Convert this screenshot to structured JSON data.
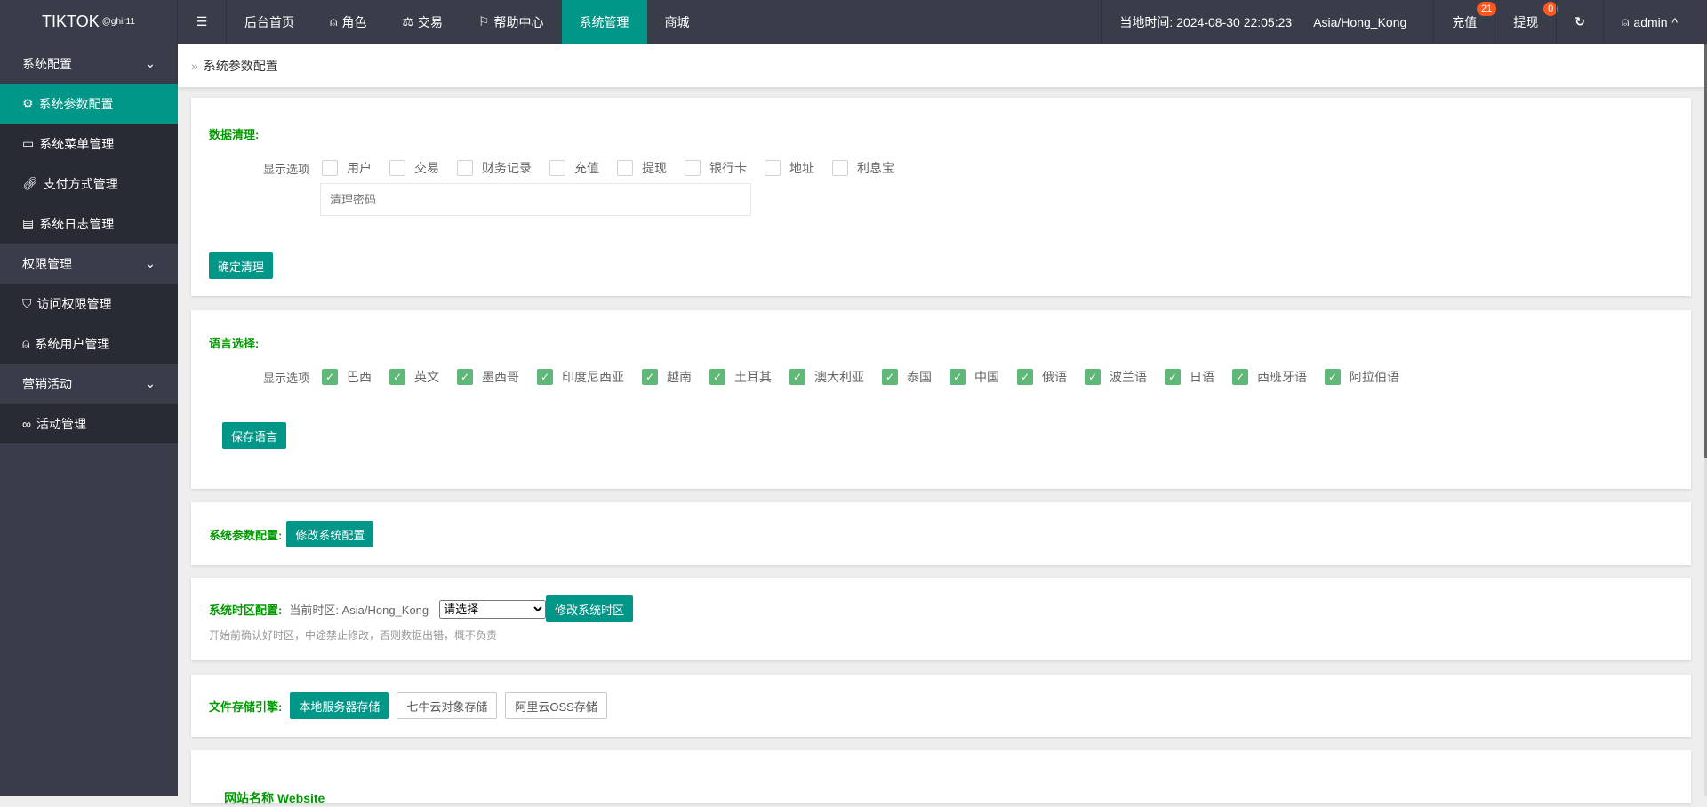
{
  "header": {
    "logo": "TIKTOK",
    "logo_sup": "@ghir11",
    "nav": [
      {
        "label": "后台首页",
        "icon": ""
      },
      {
        "label": "角色",
        "icon": "user-icon"
      },
      {
        "label": "交易",
        "icon": "scale-icon"
      },
      {
        "label": "帮助中心",
        "icon": "flag-icon"
      },
      {
        "label": "系统管理",
        "icon": "",
        "active": true
      },
      {
        "label": "商城",
        "icon": ""
      }
    ],
    "time_label": "当地时间: 2024-08-30 22:05:23",
    "timezone": "Asia/Hong_Kong",
    "recharge": "充值",
    "recharge_count": "21",
    "withdraw": "提现",
    "withdraw_count": "0",
    "user": "admin"
  },
  "sidebar": {
    "groups": [
      {
        "label": "系统配置",
        "items": [
          "系统参数配置",
          "系统菜单管理",
          "支付方式管理",
          "系统日志管理"
        ]
      },
      {
        "label": "权限管理",
        "items": [
          "访问权限管理",
          "系统用户管理"
        ]
      },
      {
        "label": "营销活动",
        "items": [
          "活动管理"
        ]
      }
    ]
  },
  "breadcrumb": "系统参数配置",
  "cleanup": {
    "title": "数据清理:",
    "label": "显示选项",
    "options": [
      "用户",
      "交易",
      "财务记录",
      "充值",
      "提现",
      "银行卡",
      "地址",
      "利息宝"
    ],
    "password_placeholder": "清理密码",
    "button": "确定清理"
  },
  "language": {
    "title": "语言选择:",
    "label": "显示选项",
    "options": [
      "巴西",
      "英文",
      "墨西哥",
      "印度尼西亚",
      "越南",
      "土耳其",
      "澳大利亚",
      "泰国",
      "中国",
      "俄语",
      "波兰语",
      "日语",
      "西班牙语",
      "阿拉伯语"
    ],
    "button": "保存语言"
  },
  "params": {
    "title": "系统参数配置:",
    "button": "修改系统配置"
  },
  "timezone": {
    "title": "系统时区配置:",
    "current": "当前时区: Asia/Hong_Kong",
    "select": "请选择",
    "button": "修改系统时区",
    "hint": "开始前确认好时区，中途禁止修改，否则数据出错，概不负责"
  },
  "storage": {
    "title": "文件存储引擎:",
    "options": [
      "本地服务器存储",
      "七牛云对象存储",
      "阿里云OSS存储"
    ]
  },
  "website": {
    "title": "网站名称 Website"
  },
  "colors": {
    "primary": "#009688",
    "header": "#393D49",
    "title": "#009900",
    "badge": "#FF5722"
  }
}
